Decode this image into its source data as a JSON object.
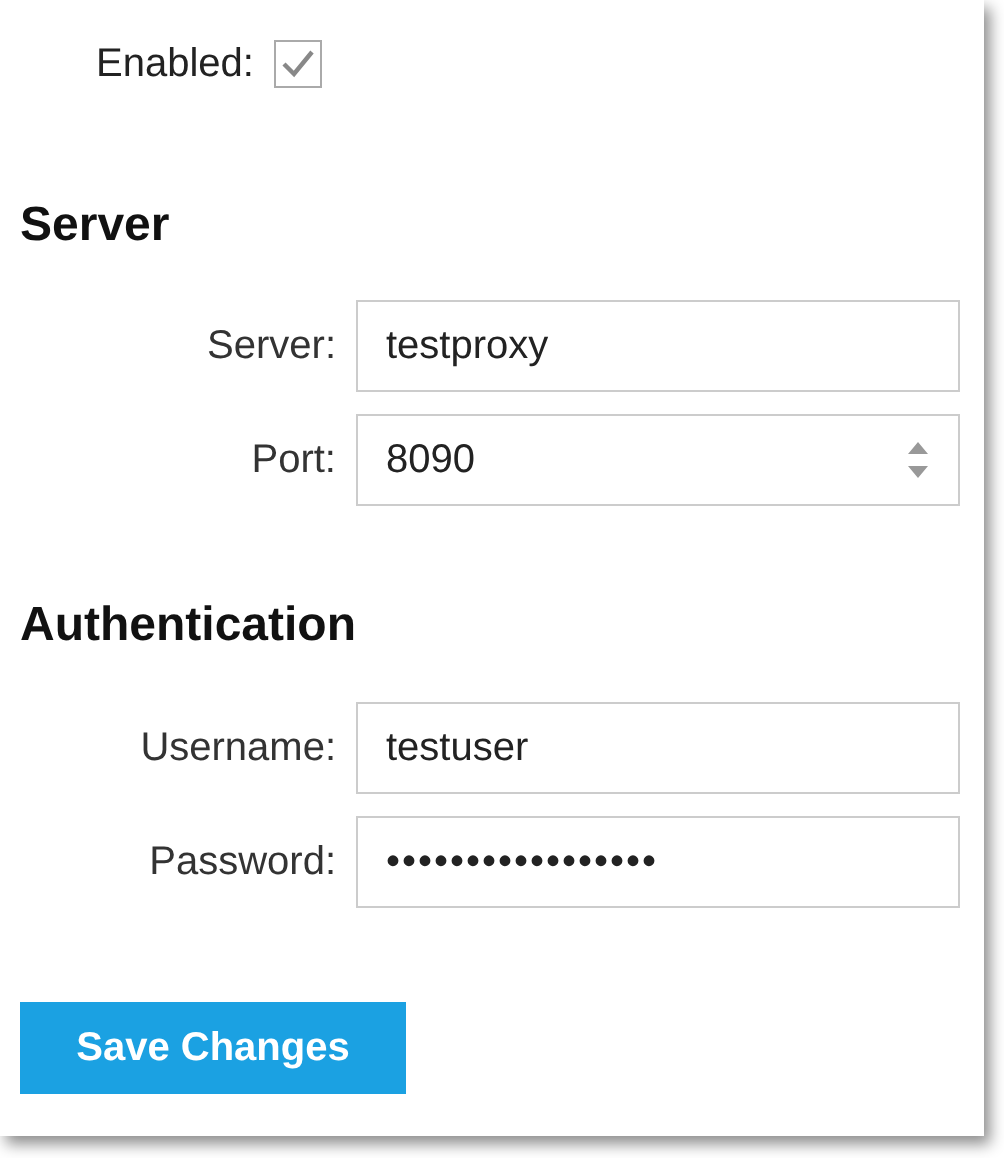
{
  "enabled": {
    "label": "Enabled:",
    "checked": true
  },
  "sections": [
    {
      "title": "Server",
      "fields": [
        {
          "kind": "text",
          "label": "Server:",
          "value": "testproxy"
        },
        {
          "kind": "number",
          "label": "Port:",
          "value": "8090"
        }
      ]
    },
    {
      "title": "Authentication",
      "fields": [
        {
          "kind": "text",
          "label": "Username:",
          "value": "testuser"
        },
        {
          "kind": "password",
          "label": "Password:",
          "value": "•••••••••••••••••"
        }
      ]
    }
  ],
  "save_button": "Save Changes"
}
